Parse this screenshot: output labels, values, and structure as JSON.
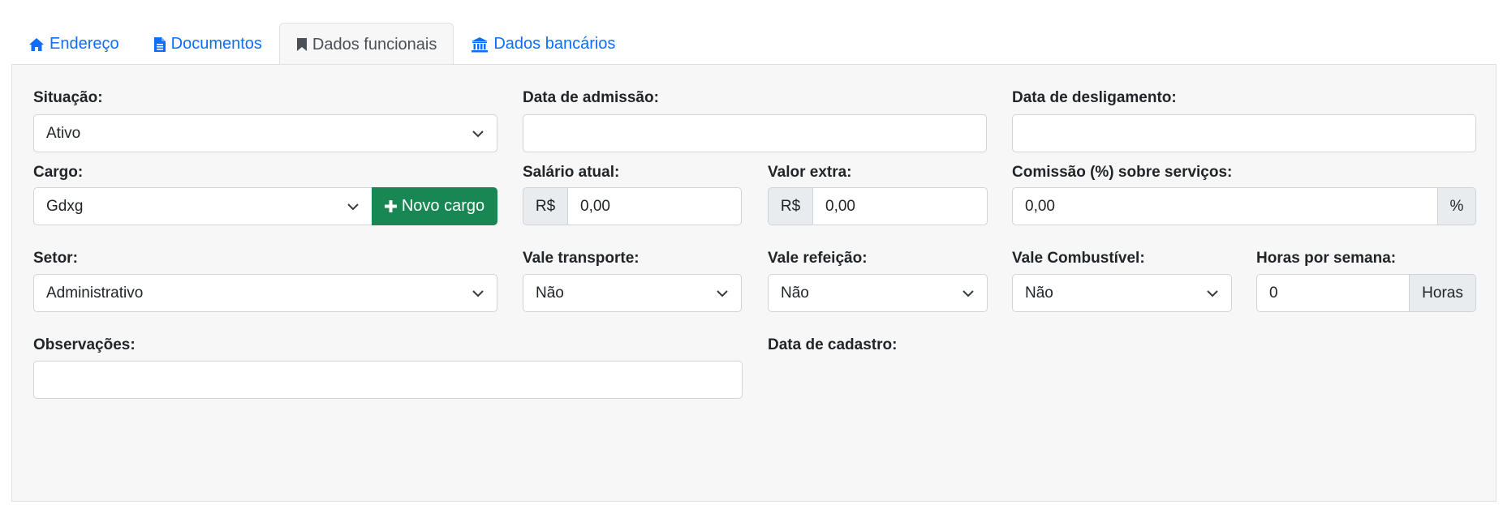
{
  "tabs": [
    {
      "label": "Endereço",
      "icon": "home-icon",
      "active": false
    },
    {
      "label": "Documentos",
      "icon": "file-text-icon",
      "active": false
    },
    {
      "label": "Dados funcionais",
      "icon": "bookmark-icon",
      "active": true
    },
    {
      "label": "Dados bancários",
      "icon": "bank-icon",
      "active": false
    }
  ],
  "form": {
    "situacao": {
      "label": "Situação:",
      "value": "Ativo"
    },
    "data_admissao": {
      "label": "Data de admissão:",
      "value": ""
    },
    "data_desligamento": {
      "label": "Data de desligamento:",
      "value": ""
    },
    "cargo": {
      "label": "Cargo:",
      "value": "Gdxg",
      "button": "Novo cargo"
    },
    "salario_atual": {
      "label": "Salário atual:",
      "prefix": "R$",
      "value": "0,00"
    },
    "valor_extra": {
      "label": "Valor extra:",
      "prefix": "R$",
      "value": "0,00"
    },
    "comissao": {
      "label": "Comissão (%) sobre serviços:",
      "value": "0,00",
      "suffix": "%"
    },
    "setor": {
      "label": "Setor:",
      "value": "Administrativo"
    },
    "vale_transporte": {
      "label": "Vale transporte:",
      "value": "Não"
    },
    "vale_refeicao": {
      "label": "Vale refeição:",
      "value": "Não"
    },
    "vale_combustivel": {
      "label": "Vale Combustível:",
      "value": "Não"
    },
    "horas_semana": {
      "label": "Horas por semana:",
      "value": "0",
      "suffix": "Horas"
    },
    "observacoes": {
      "label": "Observações:",
      "value": ""
    },
    "data_cadastro": {
      "label": "Data de cadastro:",
      "value": ""
    }
  },
  "colors": {
    "link": "#0d6efd",
    "success": "#198754",
    "panel_bg": "#f7f7f7"
  }
}
